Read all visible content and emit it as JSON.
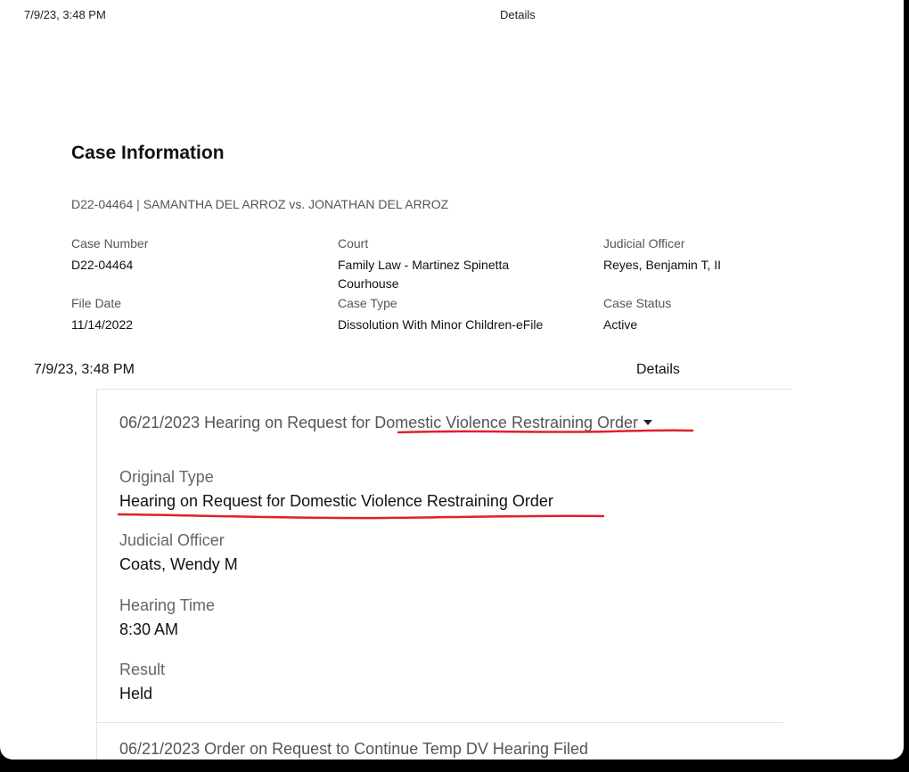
{
  "print_header_top": {
    "timestamp": "7/9/23, 3:48 PM",
    "title": "Details"
  },
  "case_info": {
    "heading": "Case Information",
    "subtitle": "D22-04464 | SAMANTHA DEL ARROZ vs. JONATHAN DEL ARROZ",
    "fields": [
      {
        "label": "Case Number",
        "value": "D22-04464"
      },
      {
        "label": "Court",
        "value": "Family Law - Martinez Spinetta Courhouse"
      },
      {
        "label": "Judicial Officer",
        "value": "Reyes, Benjamin T, II"
      },
      {
        "label": "File Date",
        "value": "11/14/2022"
      },
      {
        "label": "Case Type",
        "value": "Dissolution With Minor Children-eFile"
      },
      {
        "label": "Case Status",
        "value": "Active"
      }
    ]
  },
  "print_header_second": {
    "timestamp": "7/9/23, 3:48 PM",
    "title": "Details"
  },
  "hearing": {
    "heading_prefix": "06/21/2023 Hearing on Request for ",
    "heading_highlight": "Domestic Violence Restraining Order",
    "details": [
      {
        "label": "Original Type",
        "value": "Hearing on Request for Domestic Violence Restraining Order"
      },
      {
        "label": "Judicial Officer",
        "value": "Coats, Wendy M"
      },
      {
        "label": "Hearing Time",
        "value": "8:30 AM"
      },
      {
        "label": "Result",
        "value": "Held"
      }
    ]
  },
  "next_item": "06/21/2023 Order on Request to Continue Temp DV Hearing Filed",
  "annotation_color": "#e0202a"
}
